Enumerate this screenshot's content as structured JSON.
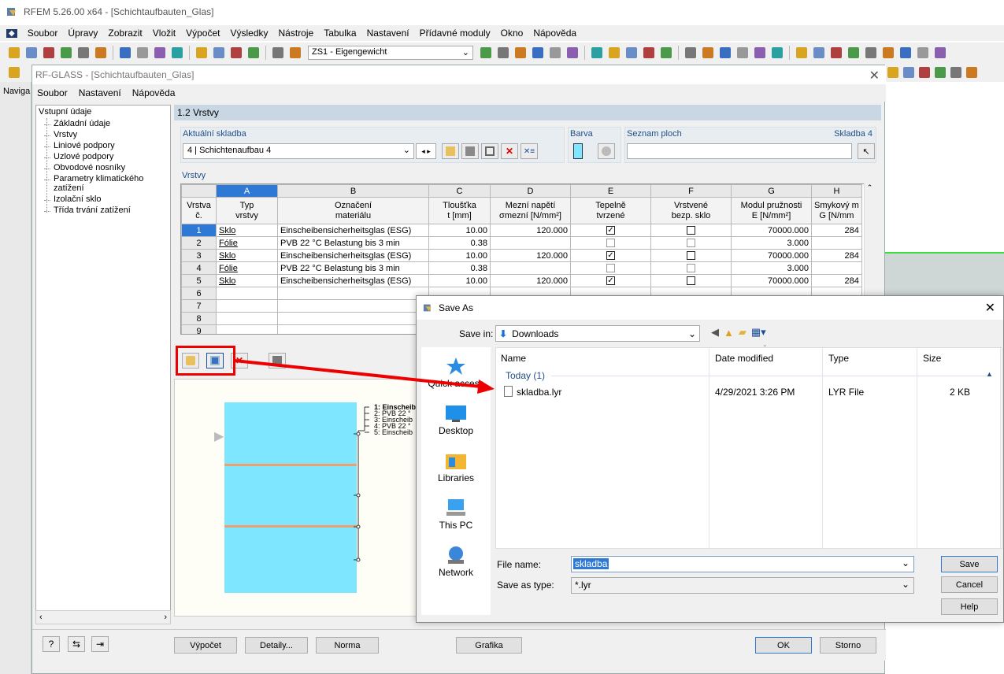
{
  "app": {
    "title": "RFEM 5.26.00 x64 - [Schichtaufbauten_Glas]",
    "menu": [
      "Soubor",
      "Úpravy",
      "Zobrazit",
      "Vložit",
      "Výpočet",
      "Výsledky",
      "Nástroje",
      "Tabulka",
      "Nastavení",
      "Přídavné moduly",
      "Okno",
      "Nápověda"
    ],
    "loadcase": "ZS1 - Eigengewicht",
    "navigator_label": "Naviga"
  },
  "rf": {
    "title": "RF-GLASS - [Schichtaufbauten_Glas]",
    "menu": [
      "Soubor",
      "Nastavení",
      "Nápověda"
    ],
    "tree": {
      "root": "Vstupní údaje",
      "items": [
        "Základní údaje",
        "Vrstvy",
        "Liniové podpory",
        "Uzlové podpory",
        "Obvodové nosníky",
        "Parametry klimatického zatížení",
        "Izolační sklo",
        "Třída trvání zatížení"
      ]
    },
    "section_title": "1.2 Vrstvy",
    "current_label": "Aktuální skladba",
    "current_value": "4 | Schichtenaufbau 4",
    "color_label": "Barva",
    "surfaces_label": "Seznam ploch",
    "surfaces_right": "Skladba 4",
    "layers_label": "Vrstvy",
    "col_letters": [
      "A",
      "B",
      "C",
      "D",
      "E",
      "F",
      "G",
      "H"
    ],
    "col_h1": [
      "Vrstva",
      "Typ",
      "Označení",
      "Tloušťka",
      "Mezní napětí",
      "Tepelně",
      "Vrstvené",
      "Modul pružnosti",
      "Smykový m"
    ],
    "col_h2": [
      "č.",
      "vrstvy",
      "materiálu",
      "t [mm]",
      "σmezní [N/mm²]",
      "tvrzené",
      "bezp. sklo",
      "E [N/mm²]",
      "G [N/mm"
    ],
    "rows": [
      {
        "n": "1",
        "type": "Sklo",
        "mat": "Einscheibensicherheitsglas (ESG)",
        "t": "10.00",
        "s": "120.000",
        "tv": true,
        "vb": false,
        "e": "70000.000",
        "g": "284"
      },
      {
        "n": "2",
        "type": "Fólie",
        "mat": "PVB 22 °C Belastung bis 3 min",
        "t": "0.38",
        "s": "",
        "tv": null,
        "vb": null,
        "e": "3.000",
        "g": ""
      },
      {
        "n": "3",
        "type": "Sklo",
        "mat": "Einscheibensicherheitsglas (ESG)",
        "t": "10.00",
        "s": "120.000",
        "tv": true,
        "vb": false,
        "e": "70000.000",
        "g": "284"
      },
      {
        "n": "4",
        "type": "Fólie",
        "mat": "PVB 22 °C Belastung bis 3 min",
        "t": "0.38",
        "s": "",
        "tv": null,
        "vb": null,
        "e": "3.000",
        "g": ""
      },
      {
        "n": "5",
        "type": "Sklo",
        "mat": "Einscheibensicherheitsglas (ESG)",
        "t": "10.00",
        "s": "120.000",
        "tv": true,
        "vb": false,
        "e": "70000.000",
        "g": "284"
      },
      {
        "n": "6"
      },
      {
        "n": "7"
      },
      {
        "n": "8"
      },
      {
        "n": "9"
      }
    ],
    "legend": [
      "1: Einscheib",
      "2: PVB 22 °",
      "3: Einscheib",
      "4: PVB 22 °",
      "5: Einscheib"
    ],
    "buttons": {
      "calc": "Výpočet",
      "details": "Detaily...",
      "norm": "Norma",
      "graphics": "Grafika",
      "ok": "OK",
      "cancel": "Storno"
    }
  },
  "dialog": {
    "title": "Save As",
    "save_in_label": "Save in:",
    "save_in": "Downloads",
    "places": [
      "Quick access",
      "Desktop",
      "Libraries",
      "This PC",
      "Network"
    ],
    "columns": [
      "Name",
      "Date modified",
      "Type",
      "Size"
    ],
    "group": "Today (1)",
    "files": [
      {
        "name": "skladba.lyr",
        "date": "4/29/2021 3:26 PM",
        "type": "LYR File",
        "size": "2 KB"
      }
    ],
    "filename_label": "File name:",
    "filename": "skladba",
    "savetype_label": "Save as type:",
    "savetype": "*.lyr",
    "save": "Save",
    "cancel": "Cancel",
    "help": "Help"
  },
  "colors": {
    "accent": "#2f79d6",
    "annotation": "#e00000",
    "glass": "#7fe6ff"
  }
}
